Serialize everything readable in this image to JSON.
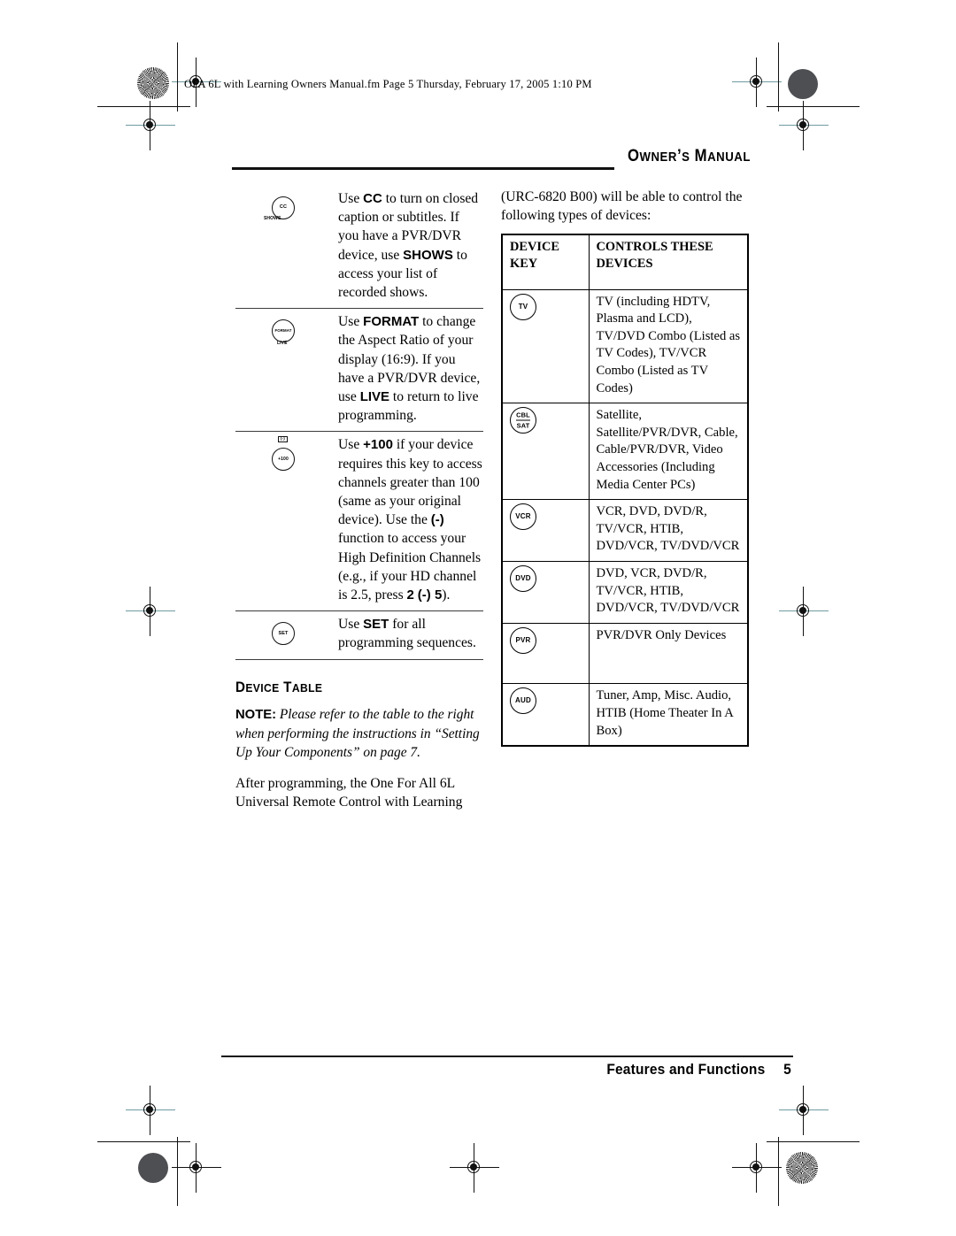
{
  "page": {
    "filename_line": "OFA 6L with Learning Owners Manual.fm  Page 5  Thursday, February 17, 2005  1:10 PM",
    "running_head": "Owner's Manual",
    "footer_section": "Features and Functions",
    "footer_page_number": "5"
  },
  "left_column": {
    "key_rows": [
      {
        "icon_main": "CC",
        "icon_sub": "SHOWS",
        "text_parts": [
          {
            "t": "Use ",
            "b": false
          },
          {
            "t": "CC",
            "b": true
          },
          {
            "t": " to turn on closed caption or subtitles. If you have a PVR/DVR device, use ",
            "b": false
          },
          {
            "t": "SHOWS",
            "b": true
          },
          {
            "t": " to access your list of recorded shows.",
            "b": false
          }
        ]
      },
      {
        "icon_main": "FORMAT",
        "icon_sub": "LIVE",
        "text_parts": [
          {
            "t": "Use ",
            "b": false
          },
          {
            "t": "FORMAT",
            "b": true
          },
          {
            "t": " to change the Aspect Ratio of your display (16:9). If you have a PVR/DVR device, use ",
            "b": false
          },
          {
            "t": "LIVE",
            "b": true
          },
          {
            "t": " to return to live programming.",
            "b": false
          }
        ]
      },
      {
        "icon_main": "+100",
        "icon_sub": "(-)",
        "text_parts": [
          {
            "t": "Use ",
            "b": false
          },
          {
            "t": "+100",
            "b": true
          },
          {
            "t": " if your device requires this key to access channels greater than 100 (same as your original device). Use the ",
            "b": false
          },
          {
            "t": "(-)",
            "b": true
          },
          {
            "t": " function to access your High Definition Channels (e.g., if your HD channel is 2.5, press ",
            "b": false
          },
          {
            "t": "2",
            "b": true
          },
          {
            "t": " ",
            "b": false
          },
          {
            "t": "(-) 5",
            "b": true
          },
          {
            "t": ").",
            "b": false
          }
        ]
      },
      {
        "icon_main": "SET",
        "icon_sub": "",
        "text_parts": [
          {
            "t": "Use ",
            "b": false
          },
          {
            "t": "SET",
            "b": true
          },
          {
            "t": " for all programming sequences.",
            "b": false
          }
        ]
      }
    ],
    "section_heading": "Device Table",
    "note_label": "NOTE:",
    "note_text": " Please refer to the table to the right when performing the instructions in “Setting Up Your Components” on page 7.",
    "body_paragraph": "After programming, the One For All 6L Universal Remote Control with Learning"
  },
  "right_column": {
    "intro_paragraph": "(URC-6820 B00) will be able to control the following types of devices:",
    "table": {
      "headers": [
        "DEVICE KEY",
        "CONTROLS THESE DEVICES"
      ],
      "rows": [
        {
          "key_label": "TV",
          "key_label_2": "",
          "devices": "TV (including HDTV, Plasma and LCD), TV/DVD Combo (Listed as TV Codes), TV/VCR Combo (Listed as TV Codes)"
        },
        {
          "key_label": "CBL",
          "key_label_2": "SAT",
          "devices": "Satellite, Satellite/PVR/DVR, Cable, Cable/PVR/DVR, Video Accessories (Including Media Center PCs)"
        },
        {
          "key_label": "VCR",
          "key_label_2": "",
          "devices": "VCR, DVD, DVD/R, TV/VCR, HTIB, DVD/VCR, TV/DVD/VCR"
        },
        {
          "key_label": "DVD",
          "key_label_2": "",
          "devices": "DVD, VCR, DVD/R, TV/VCR, HTIB, DVD/VCR, TV/DVD/VCR"
        },
        {
          "key_label": "PVR",
          "key_label_2": "",
          "devices": "PVR/DVR Only Devices"
        },
        {
          "key_label": "AUD",
          "key_label_2": "",
          "devices": "Tuner, Amp, Misc. Audio, HTIB (Home Theater In A Box)"
        }
      ]
    }
  },
  "colors": {
    "ink": "#000000",
    "page": "#ffffff",
    "registration_teal": "#6f9ba1"
  }
}
